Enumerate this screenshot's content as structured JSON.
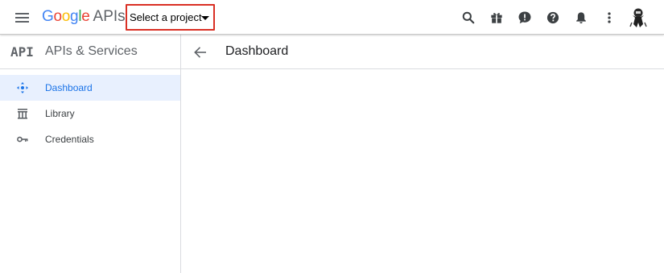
{
  "topbar": {
    "brand_google": [
      "G",
      "o",
      "o",
      "g",
      "l",
      "e"
    ],
    "brand_google_colors": [
      "#4285F4",
      "#EA4335",
      "#FBBC05",
      "#4285F4",
      "#34A853",
      "#EA4335"
    ],
    "brand_suffix": "APIs",
    "project_select_label": "Select a project",
    "icons": [
      "menu-icon",
      "search-icon",
      "gift-icon",
      "feedback-icon",
      "help-icon",
      "notifications-icon",
      "more-vert-icon",
      "account-avatar"
    ]
  },
  "sidebar": {
    "api_mark": "API",
    "title": "APIs & Services",
    "items": [
      {
        "label": "Dashboard",
        "icon": "dashboard-icon",
        "active": true
      },
      {
        "label": "Library",
        "icon": "library-icon",
        "active": false
      },
      {
        "label": "Credentials",
        "icon": "key-icon",
        "active": false
      }
    ]
  },
  "main": {
    "title": "Dashboard"
  },
  "colors": {
    "accent": "#1a73e8",
    "active_bg": "#e8f0fe",
    "highlight_border": "#d93025",
    "icon_gray": "#5f6368"
  }
}
